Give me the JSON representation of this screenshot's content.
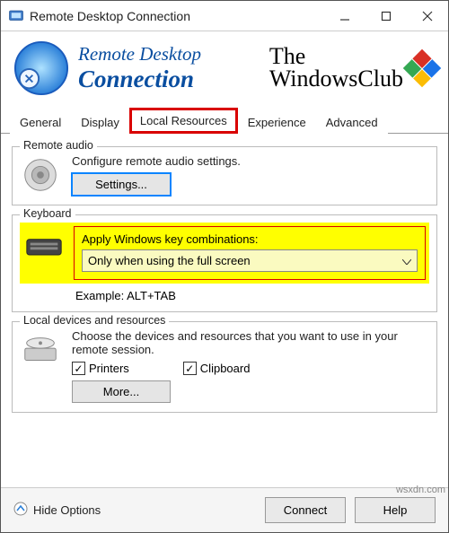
{
  "titlebar": {
    "title": "Remote Desktop Connection"
  },
  "header": {
    "line1": "Remote Desktop",
    "line2": "Connection",
    "twc_line1": "The",
    "twc_line2": "WindowsClub"
  },
  "tabs": {
    "general": "General",
    "display": "Display",
    "local_resources": "Local Resources",
    "experience": "Experience",
    "advanced": "Advanced"
  },
  "audio": {
    "legend": "Remote audio",
    "desc": "Configure remote audio settings.",
    "settings_btn": "Settings..."
  },
  "keyboard": {
    "legend": "Keyboard",
    "label": "Apply Windows key combinations:",
    "selected": "Only when using the full screen",
    "example": "Example: ALT+TAB"
  },
  "devices": {
    "legend": "Local devices and resources",
    "desc": "Choose the devices and resources that you want to use in your remote session.",
    "printers_label": "Printers",
    "printers_checked": true,
    "clipboard_label": "Clipboard",
    "clipboard_checked": true,
    "more_btn": "More..."
  },
  "bottom": {
    "hide_options": "Hide Options",
    "connect": "Connect",
    "help": "Help"
  },
  "watermark": "wsxdn.com"
}
